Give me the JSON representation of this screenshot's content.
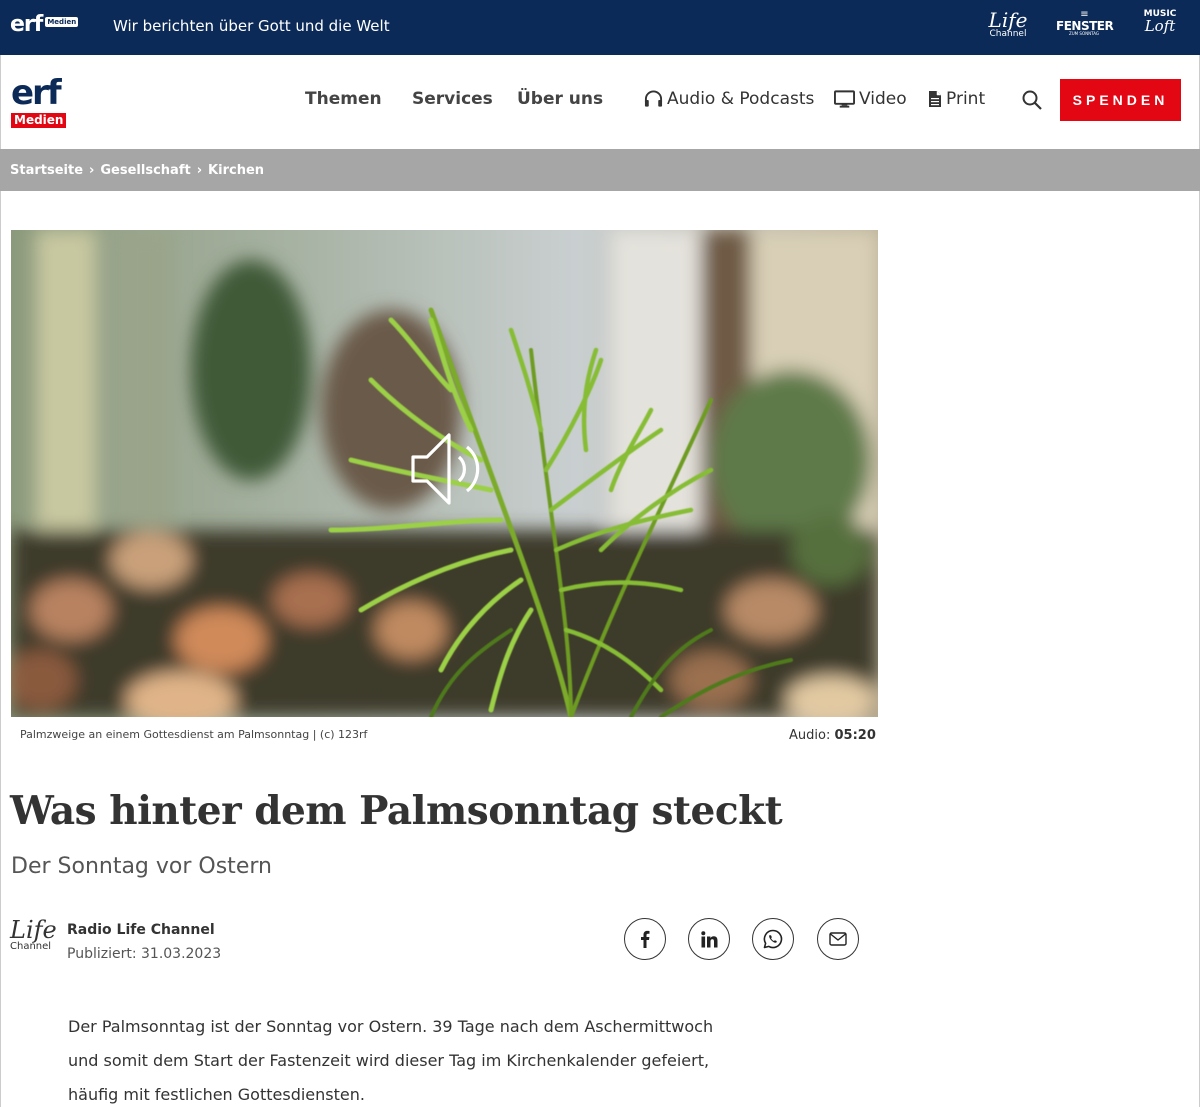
{
  "topbar": {
    "logo_text": "erf",
    "logo_badge": "Medien",
    "tagline": "Wir berichten über Gott und die Welt",
    "brands": {
      "life": {
        "line1": "Life",
        "line2": "Channel"
      },
      "fenster": {
        "line0": "≡",
        "line1": "FENSTER",
        "line2": "ZUM SONNTAG"
      },
      "music": {
        "line1": "MUSIC",
        "line2": "Loft"
      }
    },
    "background_color": "#0b2a57"
  },
  "header": {
    "logo_text": "erf",
    "logo_badge": "Medien",
    "nav": {
      "themen": "Themen",
      "services": "Services",
      "ueber": "Über uns",
      "audio": "Audio & Podcasts",
      "video": "Video",
      "print": "Print"
    },
    "icons": {
      "audio": "headphones-icon",
      "video": "monitor-icon",
      "print": "document-icon",
      "search": "search-icon"
    },
    "spenden_label": "SPENDEN",
    "accent_color": "#e30613"
  },
  "breadcrumb": {
    "items": [
      "Startseite",
      "Gesellschaft",
      "Kirchen"
    ],
    "separator": "›"
  },
  "hero": {
    "caption": "Palmzweige an einem Gottesdienst am Palmsonntag | (c) 123rf",
    "audio_label": "Audio:",
    "audio_duration": "05:20",
    "overlay_icon": "speaker-icon"
  },
  "article": {
    "title": "Was hinter dem Palmsonntag steckt",
    "subtitle": "Der Sonntag vor Ostern",
    "author_logo": {
      "line1": "Life",
      "line2": "Channel"
    },
    "author": "Radio Life Channel",
    "published": "Publiziert: 31.03.2023",
    "share_icons": [
      "facebook-icon",
      "linkedin-icon",
      "whatsapp-icon",
      "mail-icon"
    ],
    "body": "Der Palmsonntag ist der Sonntag vor Ostern. 39 Tage nach dem Aschermittwoch und somit dem Start der Fastenzeit wird dieser Tag im Kirchenkalender gefeiert, häufig mit festlichen Gottesdiensten."
  }
}
